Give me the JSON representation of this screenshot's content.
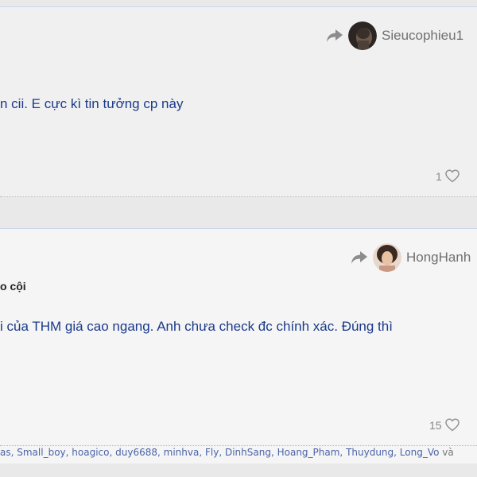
{
  "posts": [
    {
      "author": "Sieucophieu1",
      "title": "",
      "message": "n cii. E cực kì tin tưởng cp này",
      "like_count": "1"
    },
    {
      "author": "HongHanh",
      "title": "o cội",
      "message": "i của THM giá cao ngang. Anh chưa check đc chính xác. Đúng thì",
      "like_count": "15"
    }
  ],
  "likers": {
    "names": [
      "as",
      "Small_boy",
      "hoagico",
      "duy6688",
      "minhva",
      "Fly",
      "DinhSang",
      "Hoang_Pham",
      "Thuydung",
      "Long_Vo"
    ],
    "suffix": "và"
  },
  "icons": {
    "share": "share-arrow-icon",
    "like": "heart-icon"
  },
  "colors": {
    "message_text": "#1a3a8a",
    "username": "#707070",
    "liker_link": "#4a63a8"
  }
}
